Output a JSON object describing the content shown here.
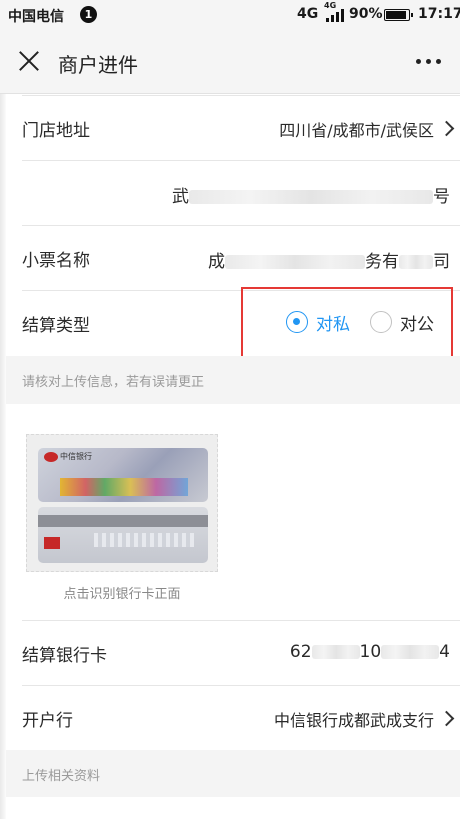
{
  "status_bar": {
    "carrier": "中国电信",
    "notification_count": "1",
    "network": "4G",
    "network_small": "4G",
    "battery_percent": "90%",
    "time": "17:17"
  },
  "header": {
    "title": "商户进件"
  },
  "form": {
    "store_address": {
      "label": "门店地址",
      "value": "四川省/成都市/武侯区"
    },
    "address_detail": {
      "prefix": "武",
      "suffix": "号"
    },
    "receipt_name": {
      "label": "小票名称",
      "prefix": "成",
      "middle": "务有",
      "suffix": "司"
    },
    "settlement_type": {
      "label": "结算类型",
      "options": [
        "对私",
        "对公"
      ],
      "selected": "对私"
    },
    "verify_hint": "请核对上传信息，若有误请更正",
    "bank_card_photo": {
      "bank_name": "中信银行",
      "caption": "点击识别银行卡正面"
    },
    "settlement_card": {
      "label": "结算银行卡",
      "prefix": "62",
      "middle": "10",
      "suffix": "4"
    },
    "opening_bank": {
      "label": "开户行",
      "value": "中信银行成都武成支行"
    },
    "upload_hint": "上传相关资料"
  },
  "colors": {
    "accent": "#2196f3",
    "highlight": "#e53935",
    "section_bg": "#f4f4f4"
  }
}
